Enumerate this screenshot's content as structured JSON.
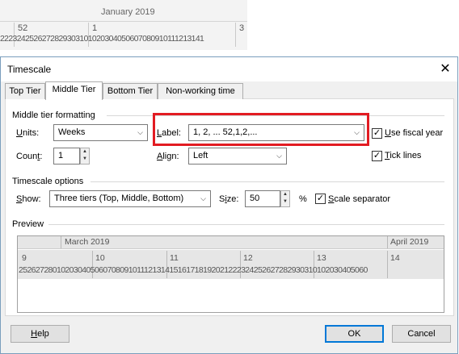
{
  "background": {
    "month": "January 2019",
    "week_a": "52",
    "week_b": "1",
    "week_c": "3",
    "days": "2223242526272829303101020304050607080910111213141"
  },
  "dialog": {
    "title": "Timescale",
    "close_glyph": "✕",
    "tabs": [
      "Top Tier",
      "Middle Tier",
      "Bottom Tier",
      "Non-working time"
    ],
    "active_tab": "Middle Tier"
  },
  "middle_tier": {
    "group_label": "Middle tier formatting",
    "units_label": "Units:",
    "units_value": "Weeks",
    "label_label": "Label:",
    "label_value": "1, 2, ... 52,1,2,...",
    "use_fiscal_year": "Use fiscal year",
    "count_label": "Count:",
    "count_value": "1",
    "align_label": "Align:",
    "align_value": "Left",
    "tick_lines": "Tick lines"
  },
  "timescale_options": {
    "group_label": "Timescale options",
    "show_label": "Show:",
    "show_value": "Three tiers (Top, Middle, Bottom)",
    "size_label": "Size:",
    "size_value": "50",
    "size_unit": "%",
    "scale_separator": "Scale separator"
  },
  "preview": {
    "group_label": "Preview",
    "month_left": "March 2019",
    "month_right": "April 2019",
    "weeks": [
      "9",
      "10",
      "11",
      "12",
      "13",
      "14"
    ],
    "days": "25262728010203040506070809101112131415161718192021222324252627282930310102030405060"
  },
  "buttons": {
    "help": "Help",
    "ok": "OK",
    "cancel": "Cancel"
  },
  "colors": {
    "highlight": "#e21b22",
    "accent": "#0078d7"
  }
}
